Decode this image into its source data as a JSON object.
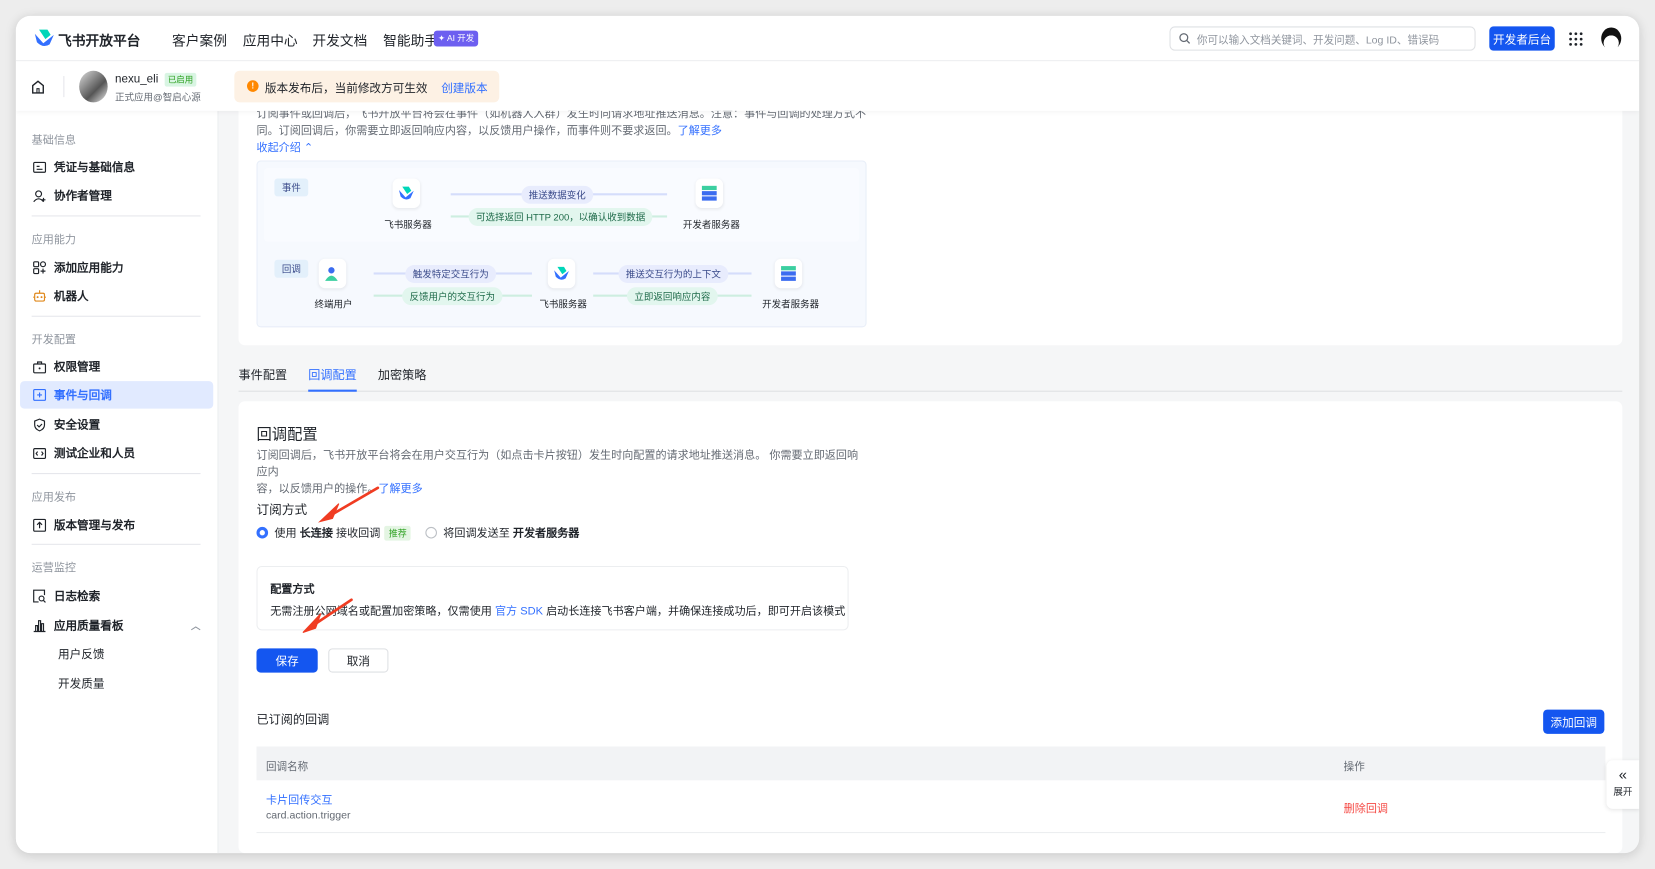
{
  "topnav": {
    "brand": "飞书开放平台",
    "items": [
      "客户案例",
      "应用中心",
      "开发文档",
      "智能助手"
    ],
    "ai_badge": "AI 开发",
    "search_placeholder": "你可以输入文档关键词、开发问题、Log ID、错误码",
    "console_button": "开发者后台"
  },
  "app": {
    "name": "nexu_eli",
    "status_badge": "已启用",
    "subtitle": "正式应用@智启心源"
  },
  "notice": {
    "text": "版本发布后，当前修改方可生效",
    "action": "创建版本",
    "color": "#ff8800"
  },
  "sidebar": {
    "groups": [
      {
        "title": "基础信息",
        "items": [
          {
            "label": "凭证与基础信息",
            "icon": "id-card-icon"
          },
          {
            "label": "协作者管理",
            "icon": "user-add-icon"
          }
        ]
      },
      {
        "title": "应用能力",
        "items": [
          {
            "label": "添加应用能力",
            "icon": "apps-add-icon"
          },
          {
            "label": "机器人",
            "icon": "robot-icon"
          }
        ]
      },
      {
        "title": "开发配置",
        "items": [
          {
            "label": "权限管理",
            "icon": "briefcase-icon"
          },
          {
            "label": "事件与回调",
            "icon": "event-icon",
            "active": true
          },
          {
            "label": "安全设置",
            "icon": "shield-icon"
          },
          {
            "label": "测试企业和人员",
            "icon": "code-icon"
          }
        ]
      },
      {
        "title": "应用发布",
        "items": [
          {
            "label": "版本管理与发布",
            "icon": "upload-icon"
          }
        ]
      },
      {
        "title": "运营监控",
        "items": [
          {
            "label": "日志检索",
            "icon": "log-search-icon"
          },
          {
            "label": "应用质量看板",
            "icon": "bar-chart-icon",
            "expanded": true,
            "children": [
              "用户反馈",
              "开发质量"
            ]
          }
        ]
      }
    ]
  },
  "intro": {
    "line1": "订阅事件或回调后，飞书开放平台将会在事件（如机器人入群）发生时向请求地址推送消息。注意：事件与回调的处理方式不",
    "line2": "同。订阅回调后，你需要立即返回响应内容，以反馈用户操作，而事件则不要求返回。",
    "learn_more": "了解更多",
    "collapse": "收起介绍",
    "diagram": {
      "event_tag": "事件",
      "callback_tag": "回调",
      "feishu_server": "飞书服务器",
      "dev_server": "开发者服务器",
      "end_user": "终端用户",
      "event_push": "推送数据变化",
      "event_return": "可选择返回 HTTP 200，以确认收到数据",
      "cb_trigger": "触发特定交互行为",
      "cb_feedback": "反馈用户的交互行为",
      "cb_push": "推送交互行为的上下文",
      "cb_return": "立即返回响应内容"
    }
  },
  "tabs": [
    {
      "label": "事件配置"
    },
    {
      "label": "回调配置",
      "active": true
    },
    {
      "label": "加密策略"
    }
  ],
  "callback_config": {
    "title": "回调配置",
    "desc1": "订阅回调后，飞书开放平台将会在用户交互行为（如点击卡片按钮）发生时向配置的请求地址推送消息。 你需要立即返回响应内",
    "desc2": "容，以反馈用户的操作。",
    "learn_more": "了解更多",
    "subscribe_label": "订阅方式",
    "option1": {
      "pre": "使用",
      "bold": "长连接",
      "post": "接收回调",
      "badge": "推荐",
      "selected": true
    },
    "option2": {
      "pre": "将回调发送至",
      "bold": "开发者服务器",
      "selected": false
    },
    "config_box": {
      "title": "配置方式",
      "text_pre": "无需注册公网域名或配置加密策略，仅需使用",
      "sdk_link": "官方 SDK",
      "text_post": "启动长连接飞书客户端，并确保连接成功后，即可开启该模式"
    },
    "save": "保存",
    "cancel": "取消"
  },
  "subscribed": {
    "title": "已订阅的回调",
    "add_button": "添加回调",
    "columns": [
      "回调名称",
      "操作"
    ],
    "rows": [
      {
        "name": "卡片回传交互",
        "key": "card.action.trigger",
        "action": "删除回调"
      }
    ]
  },
  "expand": {
    "label": "展开"
  },
  "colors": {
    "primary": "#3370ff",
    "button": "#1456f0",
    "danger": "#f54a45",
    "annotation_arrow": "#f03c22"
  }
}
